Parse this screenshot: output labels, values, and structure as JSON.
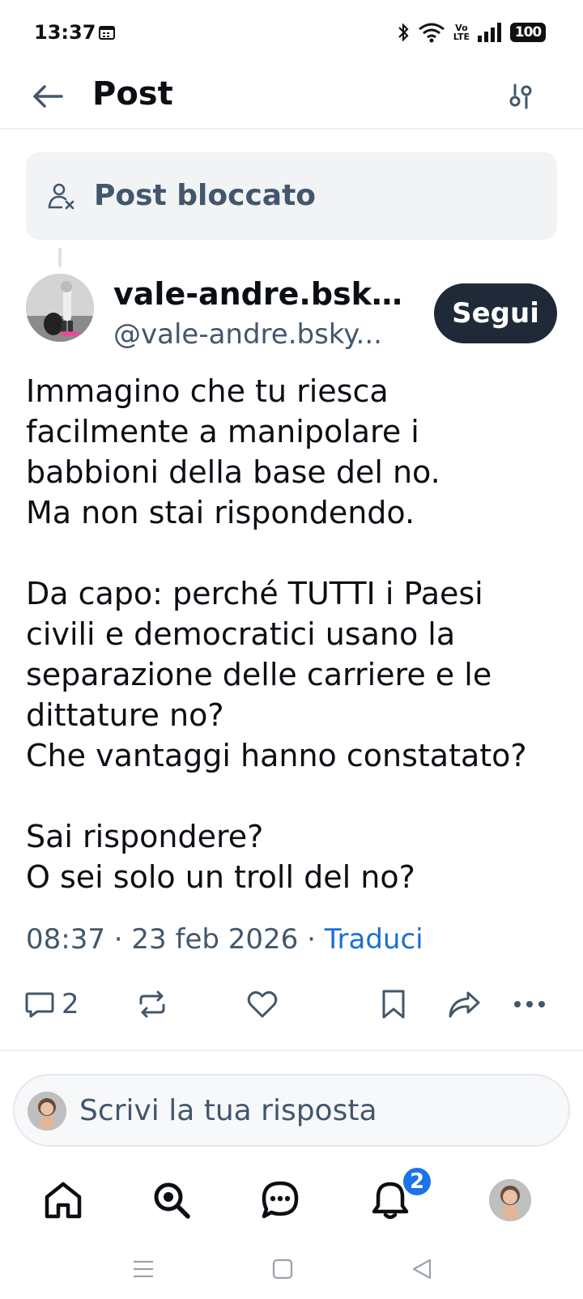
{
  "status_bar": {
    "time": "13:37",
    "volte_top": "Vo",
    "volte_bottom": "LTE",
    "battery": "100"
  },
  "header": {
    "title": "Post",
    "icons": {
      "back": "arrow-left-icon",
      "filter": "sliders-icon"
    }
  },
  "blocked_post": {
    "label": "Post bloccato",
    "icon": "person-x-icon"
  },
  "post": {
    "author_name": "vale-andre.bsky...",
    "author_handle": "@vale-andre.bsky...",
    "follow_label": "Segui",
    "text": "Immagino che tu riesca\nfacilmente a manipolare i\nbabbioni della base del no.\nMa non stai rispondendo.\n\nDa capo: perché TUTTI i Paesi\ncivili e democratici usano la\nseparazione delle carriere e le\ndittature no?\nChe vantaggi hanno constatato?\n\nSai rispondere?\nO sei solo un troll del no?",
    "time": "08:37",
    "date": "23 feb 2026",
    "separator": "·",
    "translate_label": "Traduci",
    "reply_count": "2"
  },
  "composer": {
    "placeholder": "Scrivi la tua risposta"
  },
  "bottom_nav": {
    "notifications_badge": "2",
    "items": [
      "home-icon",
      "search-icon",
      "chat-icon",
      "bell-icon",
      "profile-avatar"
    ]
  },
  "colors": {
    "text": "#0b0f14",
    "muted": "#42576c",
    "link": "#1a6fd4",
    "follow_bg": "#1f2937",
    "badge": "#1a73e8"
  }
}
